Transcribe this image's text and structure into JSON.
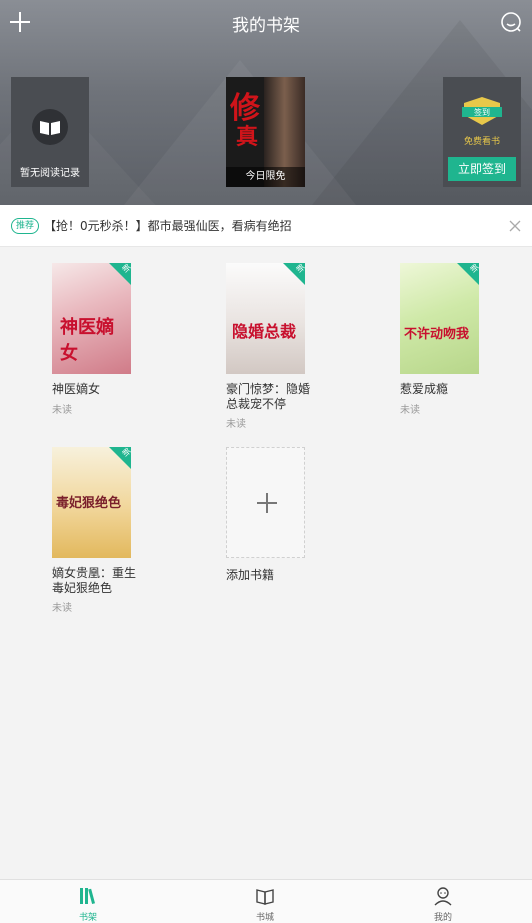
{
  "colors": {
    "accent": "#1fb58f",
    "header_bg": "#6f737a"
  },
  "header": {
    "title": "我的书架",
    "history_label": "暂无阅读记录",
    "free_tag": "今日限免",
    "free_book_title_top": "修",
    "free_book_title_bottom": "真",
    "sign_badge_text": "签到",
    "sign_free_text": "免费看书",
    "sign_button": "立即签到"
  },
  "recommend": {
    "tag": "推荐",
    "text": "【抢！0元秒杀！】都市最强仙医，看病有绝招"
  },
  "books": [
    {
      "title": "神医嫡女",
      "status": "未读",
      "badge": "新",
      "cover_text": "神医嫡女"
    },
    {
      "title": "豪门惊梦：隐婚总裁宠不停",
      "status": "未读",
      "badge": "新",
      "cover_text": "隐婚总裁"
    },
    {
      "title": "惹爱成瘾",
      "status": "未读",
      "badge": "新",
      "cover_text": "不许动吻我"
    },
    {
      "title": "嫡女贵凰：重生毒妃狠绝色",
      "status": "未读",
      "badge": "新",
      "cover_text": "毒妃狠绝色"
    }
  ],
  "add_book_label": "添加书籍",
  "nav": [
    {
      "label": "书架",
      "icon": "bookshelf-icon",
      "active": true
    },
    {
      "label": "书城",
      "icon": "book-open-icon",
      "active": false
    },
    {
      "label": "我的",
      "icon": "user-icon",
      "active": false
    }
  ]
}
